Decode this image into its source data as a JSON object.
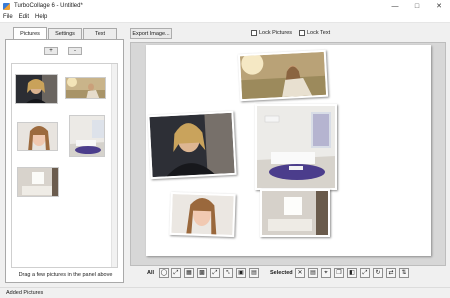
{
  "window": {
    "title": "TurboCollage 6 - Untitled*",
    "minimize_icon": "minimize-icon",
    "maximize_icon": "maximize-icon",
    "close_icon": "close-icon"
  },
  "menu": [
    "File",
    "Edit",
    "Help"
  ],
  "tabs": [
    {
      "label": "Pictures",
      "active": true
    },
    {
      "label": "Settings",
      "active": false
    },
    {
      "label": "Text",
      "active": false
    }
  ],
  "panel": {
    "add_label": "+",
    "remove_label": "-",
    "hint": "Drag a few pictures in the panel above"
  },
  "thumbnails": [
    "woman-dark-portrait",
    "woman-sitting-field",
    "woman-smiling-portrait",
    "living-room-interior",
    "bedroom-interior"
  ],
  "toolbar": {
    "export_label": "Export Image...",
    "lock_pictures_label": "Lock Pictures",
    "lock_text_label": "Lock Text"
  },
  "collage_photos": [
    "woman-sitting-field",
    "woman-dark-portrait",
    "living-room-interior",
    "woman-smiling-portrait",
    "bedroom-interior"
  ],
  "bottom_bar": {
    "all_label": "All",
    "selected_label": "Selected",
    "all_tools": [
      "shuffle-icon",
      "fit-icon",
      "grid-icon",
      "layout-icon",
      "expand-icon",
      "shrink-icon",
      "fill-icon",
      "align-icon"
    ],
    "selected_tools": [
      "delete-icon",
      "replace-icon",
      "crop-icon",
      "duplicate-icon",
      "bring-front-icon",
      "expand-icon",
      "rotate-icon",
      "flip-icon",
      "flip-vertical-icon"
    ]
  },
  "status": {
    "text": "Added Pictures"
  },
  "colors": {
    "purple_rug": "#4b3d8c",
    "shadow": "#000000"
  }
}
